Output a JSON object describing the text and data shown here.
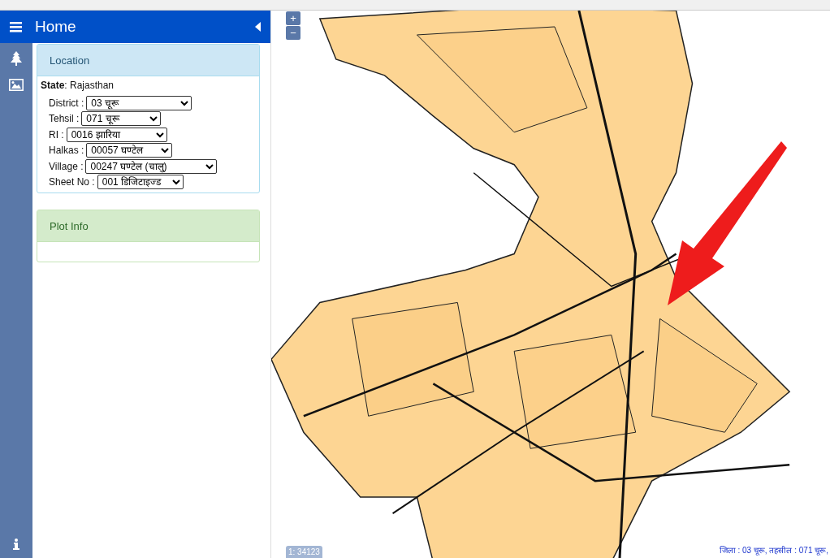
{
  "header": {
    "title": "Home"
  },
  "location": {
    "title": "Location",
    "state": "**State**: Rajasthan",
    "fields": [
      {
        "label": "District :",
        "value": "03 चूरू"
      },
      {
        "label": "Tehsil :",
        "value": "071 चूरू"
      },
      {
        "label": "RI :",
        "value": "0016 झारिया"
      },
      {
        "label": "Halkas :",
        "value": "00057 घण्टेल"
      },
      {
        "label": "Village :",
        "value": "00247 घण्टेल (चालु)"
      },
      {
        "label": "Sheet No :",
        "value": "001 डिजिटाइज्ड"
      }
    ]
  },
  "plot_info": {
    "title": "Plot Info"
  },
  "map": {
    "zoom_in": "+",
    "zoom_out": "−",
    "scale": "1: 34123",
    "footer": "जिला : 03 चूरू, तहसील : 071 चूरू,"
  }
}
